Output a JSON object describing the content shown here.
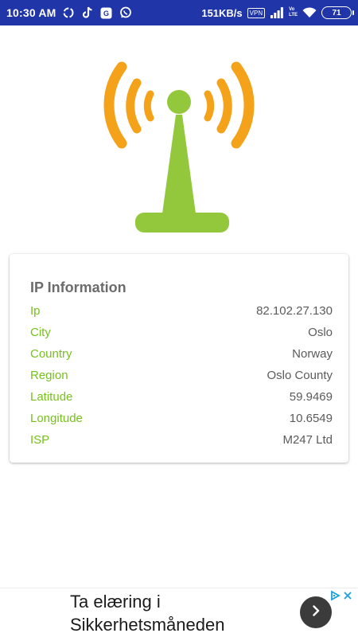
{
  "status_bar": {
    "time": "10:30 AM",
    "net_speed": "151KB/s",
    "vpn": "VPN",
    "volte_top": "Vo",
    "volte_bottom": "LTE",
    "battery": "71",
    "icons": [
      "sync-icon",
      "tiktok-icon",
      "g-app-icon",
      "whatsapp-icon",
      "vpn-icon",
      "signal-icon",
      "volte-icon",
      "wifi-icon",
      "battery-icon"
    ]
  },
  "illustration": {
    "icon": "antenna-tower-icon",
    "colors": {
      "wave": "#f4a21a",
      "tower": "#93c83c"
    }
  },
  "ip_card": {
    "title": "IP Information",
    "rows": [
      {
        "label": "Ip",
        "value": "82.102.27.130"
      },
      {
        "label": "City",
        "value": "Oslo"
      },
      {
        "label": "Country",
        "value": "Norway"
      },
      {
        "label": "Region",
        "value": "Oslo County"
      },
      {
        "label": "Latitude",
        "value": "59.9469"
      },
      {
        "label": "Longitude",
        "value": "10.6549"
      },
      {
        "label": "ISP",
        "value": "M247 Ltd"
      }
    ],
    "colors": {
      "label": "#77c11c",
      "value": "#5b5b5b",
      "title": "#6b6b6b"
    }
  },
  "ad": {
    "line1": "Ta elæring i",
    "line2": "Sikkerhetsmåneden",
    "icons": [
      "adchoices-icon",
      "close-ad-icon",
      "chevron-right-icon"
    ]
  },
  "theme": {
    "status_bar_bg": "#1f35a8",
    "accent": "#77c11c"
  }
}
